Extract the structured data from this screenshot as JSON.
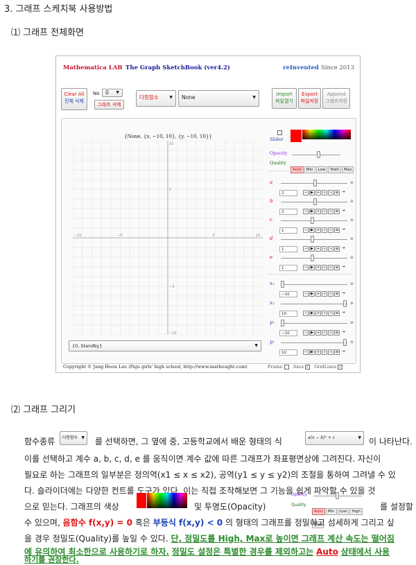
{
  "doc": {
    "section_title": "3. 그래프 스케치북 사용방법",
    "sub1": "⑴ 그래프 전체화면",
    "sub2": "⑵ 그래프 그리기"
  },
  "app": {
    "brand_left": "Mathematica LAB",
    "brand_mid": "The Graph SketchBook (ver4.2)",
    "brand_right": "reInvented",
    "brand_since": "Since 2013",
    "clear_all": "Clear All",
    "clear_all_ko": "전체 삭제",
    "no_label": "No",
    "no_value": "0",
    "graph_delete": "그래프 삭제",
    "func_type": "다항함수",
    "func_value": "None",
    "import": "Import",
    "import_ko": "파일열기",
    "export": "Export",
    "export_ko": "파일저장",
    "append": "Append",
    "append_ko": "그래프저장",
    "plot_title": "{None, {x, −10, 10}, {y, −10, 10}}",
    "status": "{0, Standby}",
    "slider_label": "Slider",
    "opacity_label": "Opacity",
    "quality_label": "Quality",
    "quality_options": [
      "Auto",
      "Min",
      "Low",
      "High",
      "Max"
    ],
    "params": [
      {
        "name": "a",
        "value": "2",
        "frac": 0.52
      },
      {
        "name": "b",
        "value": "2",
        "frac": 0.52
      },
      {
        "name": "c",
        "value": "1",
        "frac": 0.48
      },
      {
        "name": "d",
        "value": "1",
        "frac": 0.48
      },
      {
        "name": "e",
        "value": "1",
        "frac": 0.48
      }
    ],
    "ranges": [
      {
        "name": "x₁",
        "value": "−10",
        "frac": 0.0
      },
      {
        "name": "x₂",
        "value": "10",
        "frac": 1.0
      },
      {
        "name": "y₁",
        "value": "−10",
        "frac": 0.0
      },
      {
        "name": "y₂",
        "value": "10",
        "frac": 1.0
      }
    ],
    "axis_ticks": {
      "x": [
        "−10",
        "−5",
        "5",
        "10"
      ],
      "y": [
        "10",
        "5",
        "−5",
        "−10"
      ]
    },
    "copyright": "Copyright © Jang Hoon Lee (Paju girls' high school, http://www.mathought.com)",
    "frame_label": "Frame",
    "axes_label": "Axes",
    "gridlines_label": "GridLines"
  },
  "body": {
    "l1a": "함수종류",
    "sel_small": "다항함수",
    "l1b": "를 선택하면, 그 옆에 중, 고등학교에서 배운 형태의 식",
    "sel_expr": "a(x − b)² + c",
    "l1c": "이 나타난다.",
    "l2": "이를 선택하고 계수 a, b, c, d, e 를 움직이면 계수 값에 따른 그래프가 좌표평면상에 그려진다. 자신이",
    "l3": "필요로 하는 그래프의 일부분은 정의역(x1 ≤ x ≤ x2), 공역(y1 ≤ y ≤ y2)의 조절을 통하여 그려낼 수 있",
    "l4": "다. 슬라이더에는 다양한 컨트롤 도구가 있다. 이는 직접 조작해보면 그 기능을 쉽게 파악할 수 있을 것",
    "l5a": "으로 믿는다. 그래프의 색상",
    "l5b": "및 투명도(Opacity)",
    "l5c": "를 설정할",
    "l6a": "수 있으며,",
    "l6b": "음함수 f(x,y) = 0",
    "l6c": "혹은",
    "l6d": "부등식 f(x,y) < 0",
    "l6e": "의 형태의 그래프를 정밀하고 섬세하게 그리고 싶",
    "l7a": "을 경우 정밀도(Quality)를 높일 수 있다.",
    "l7b": "단, 정밀도를 High, Max로 높이면 그래프 계산 속도는 떨어짐",
    "l8a": "에 유의하여 최소한으로 사용하기로 하자.",
    "l8b": "정밀도 설정은 특별한 경우를 제외하고는",
    "l8c": "Auto",
    "l8d": "상태에서 사용",
    "l9": "하기를 권장한다."
  }
}
